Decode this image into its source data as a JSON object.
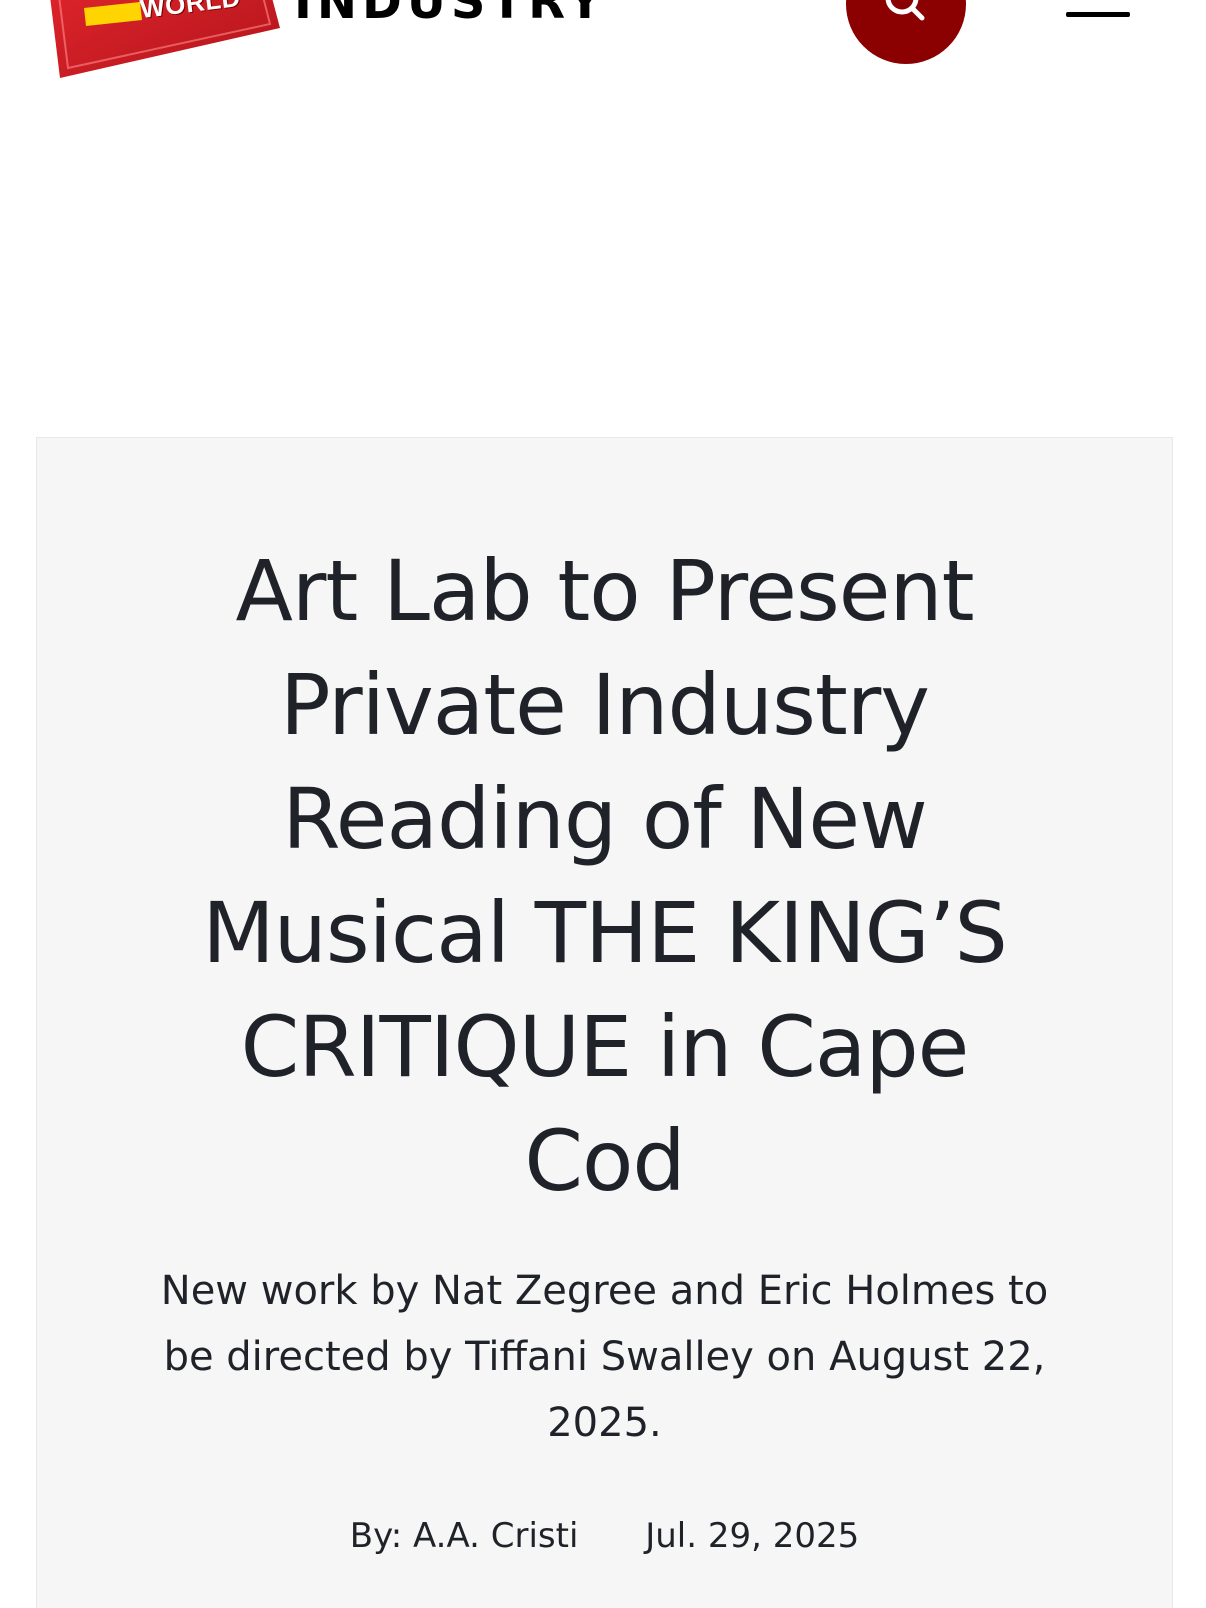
{
  "header": {
    "logo_text": "WORLD",
    "section_label": "INDUSTRY",
    "brand_color": "#8b0000",
    "search_icon": "search-icon",
    "menu_icon": "hamburger-menu-icon"
  },
  "article": {
    "headline_lines": [
      "Art Lab to Present",
      "Private Industry",
      "Reading of New",
      "Musical THE KING’S",
      "CRITIQUE in Cape",
      "Cod"
    ],
    "subhead_lines": [
      "New work by Nat Zegree and Eric Holmes to",
      "be directed by Tiffani Swalley on August 22,",
      "2025."
    ],
    "byline": "By: A.A. Cristi",
    "date": "Jul. 29, 2025"
  },
  "colors": {
    "card_background": "#f6f6f6",
    "text": "#1f2329",
    "logo_red": "#d61f26"
  }
}
